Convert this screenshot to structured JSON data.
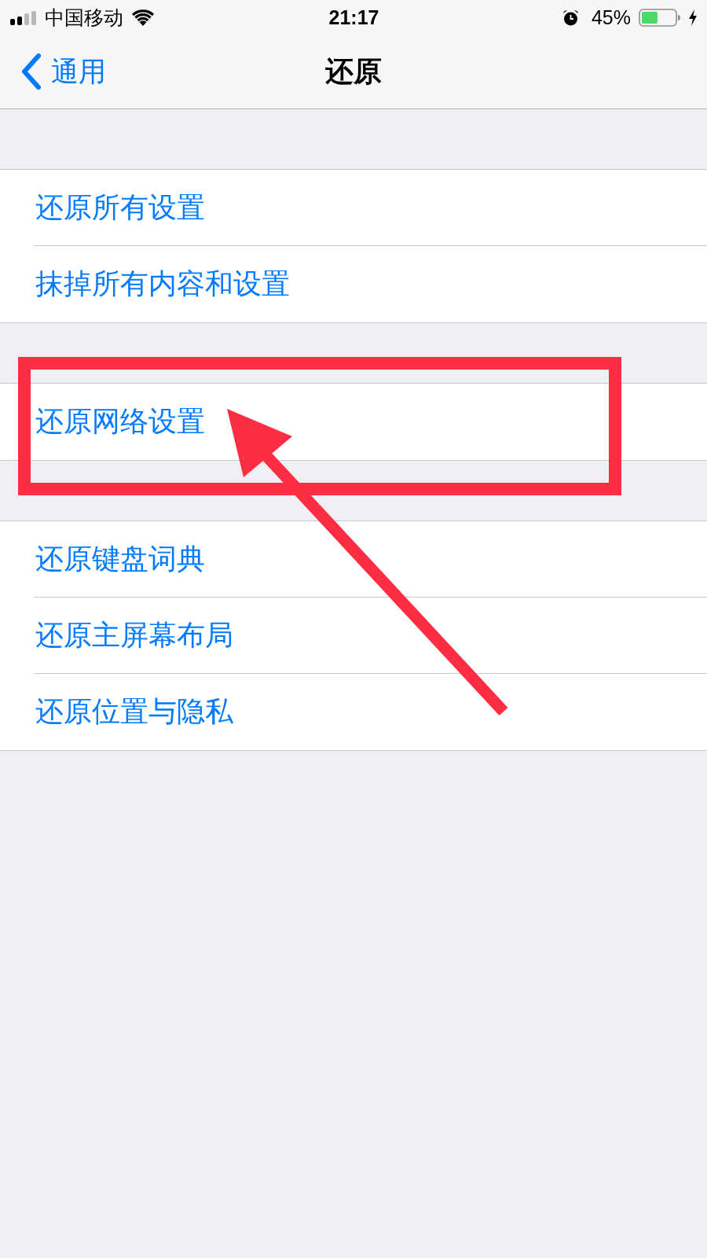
{
  "status_bar": {
    "carrier": "中国移动",
    "time": "21:17",
    "battery_text": "45%"
  },
  "nav_bar": {
    "back_label": "通用",
    "title": "还原"
  },
  "groups": [
    {
      "items": [
        {
          "label": "还原所有设置",
          "highlighted": false
        },
        {
          "label": "抹掉所有内容和设置",
          "highlighted": false
        }
      ]
    },
    {
      "items": [
        {
          "label": "还原网络设置",
          "highlighted": true
        }
      ]
    },
    {
      "items": [
        {
          "label": "还原键盘词典",
          "highlighted": false
        },
        {
          "label": "还原主屏幕布局",
          "highlighted": false
        },
        {
          "label": "还原位置与隐私",
          "highlighted": false
        }
      ]
    }
  ]
}
